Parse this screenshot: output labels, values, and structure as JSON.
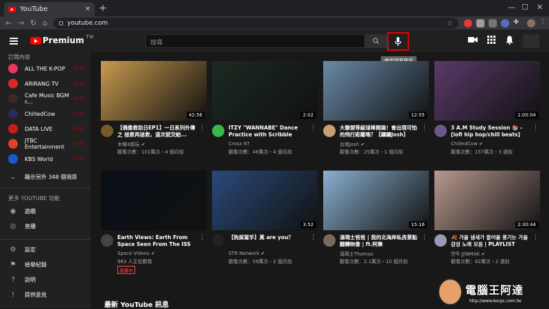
{
  "browser": {
    "tab_title": "YouTube",
    "tab_close": "✕",
    "new_tab": "+",
    "url": "youtube.com"
  },
  "header": {
    "logo_text": "Premium",
    "logo_region": "TW",
    "search_placeholder": "搜尋",
    "mic_tooltip": "使用語音搜尋"
  },
  "sidebar": {
    "subs_heading": "訂閱內容",
    "subscriptions": [
      {
        "label": "ALL THE K-POP",
        "live": true,
        "color": "#e8385a"
      },
      {
        "label": "ARIRANG TV",
        "live": true,
        "color": "#d62a2a"
      },
      {
        "label": "Cafe Music BGM c...",
        "live": true,
        "color": "#3a2a20"
      },
      {
        "label": "ChilledCow",
        "live": true,
        "color": "#2a2a5a"
      },
      {
        "label": "DATA LIVE",
        "live": true,
        "color": "#c81e1e"
      },
      {
        "label": "JTBC Entertainment",
        "live": true,
        "color": "#e04030"
      },
      {
        "label": "KBS World",
        "live": true,
        "color": "#1a5ac8"
      }
    ],
    "show_more": "顯示另外 348 個項目",
    "more_heading": "更多 YOUTUBE 功能",
    "features": [
      {
        "label": "遊戲",
        "icon": "gamepad-icon"
      },
      {
        "label": "直播",
        "icon": "live-broadcast-icon"
      }
    ],
    "settings": [
      {
        "label": "設定",
        "icon": "gear-icon"
      },
      {
        "label": "檢舉紀錄",
        "icon": "flag-icon"
      },
      {
        "label": "說明",
        "icon": "help-icon"
      },
      {
        "label": "提供意見",
        "icon": "feedback-icon"
      }
    ]
  },
  "videos": [
    {
      "title": "【偶像救助日EP1】一日系列外傳 之 拯救再拯救，遠次就交給...",
      "channel": "木曜4超玩",
      "verified": true,
      "stats": "觀看次數：101萬次・4 個月前",
      "duration": "42:56",
      "thumb": "#c89a50",
      "avatar": "#7a5a2a"
    },
    {
      "title": "ITZY \"WANNABE\" Dance Practice with Scribble Effect",
      "channel": "Crosx 97",
      "verified": false,
      "stats": "觀看次數：48萬次・4 個月前",
      "duration": "2:02",
      "thumb": "#1c2a22",
      "avatar": "#3ab84a"
    },
    {
      "title": "大聯盟等級球棒開箱！會出現可怕的飛行距離嗎？【鑄鑄Josh】",
      "channel": "台南Josh",
      "verified": true,
      "stats": "觀看次數：25萬次・1 個月前",
      "duration": "12:55",
      "thumb": "#6a8aa8",
      "avatar": "#c8a070"
    },
    {
      "title": "3 A.M Study Session 📚 - [lofi hip hop/chill beats]",
      "channel": "ChilledCow",
      "verified": true,
      "stats": "觀看次數：157萬次・3 週前",
      "duration": "1:00:04",
      "thumb": "#5a3a6a",
      "avatar": "#6a5a8a"
    },
    {
      "title": "Earth Views: Earth From Space Seen From The ISS",
      "channel": "Space Videos",
      "verified": true,
      "stats": "963 人正在觀看",
      "badge": "直播中",
      "duration": "",
      "thumb": "#0a1018",
      "avatar": "#444444"
    },
    {
      "title": "【狗屎寫手】莫 are you？",
      "channel": "STR Network",
      "verified": true,
      "stats": "觀看次數：59萬次・2 個月前",
      "duration": "3:52",
      "thumb": "#2a4a7a",
      "avatar": "#222222"
    },
    {
      "title": "湯瑪士爸爸 | 我的北海岸私房景點翻轉映像 | ft.阿樂",
      "channel": "湯瑪士Thomas",
      "verified": false,
      "stats": "觀看次數：2.1萬次・10 個月前",
      "duration": "15:16",
      "thumb": "#8ab0d0",
      "avatar": "#7a6a5a"
    },
    {
      "title": "🍂 가을 냄새가 들어올 풍기는 가을 감성 노래 모음 | PLAYLIST",
      "channel": "찐먹 JJINMAK",
      "verified": true,
      "stats": "觀看次數：82萬次・2 週前",
      "duration": "2:30:44",
      "thumb": "#b89a90",
      "avatar": "#9a9ab8"
    }
  ],
  "section_title": "最新 YouTube 訊息",
  "watermark": {
    "text": "電腦王阿達",
    "url": "http://www.kocpc.com.tw"
  }
}
